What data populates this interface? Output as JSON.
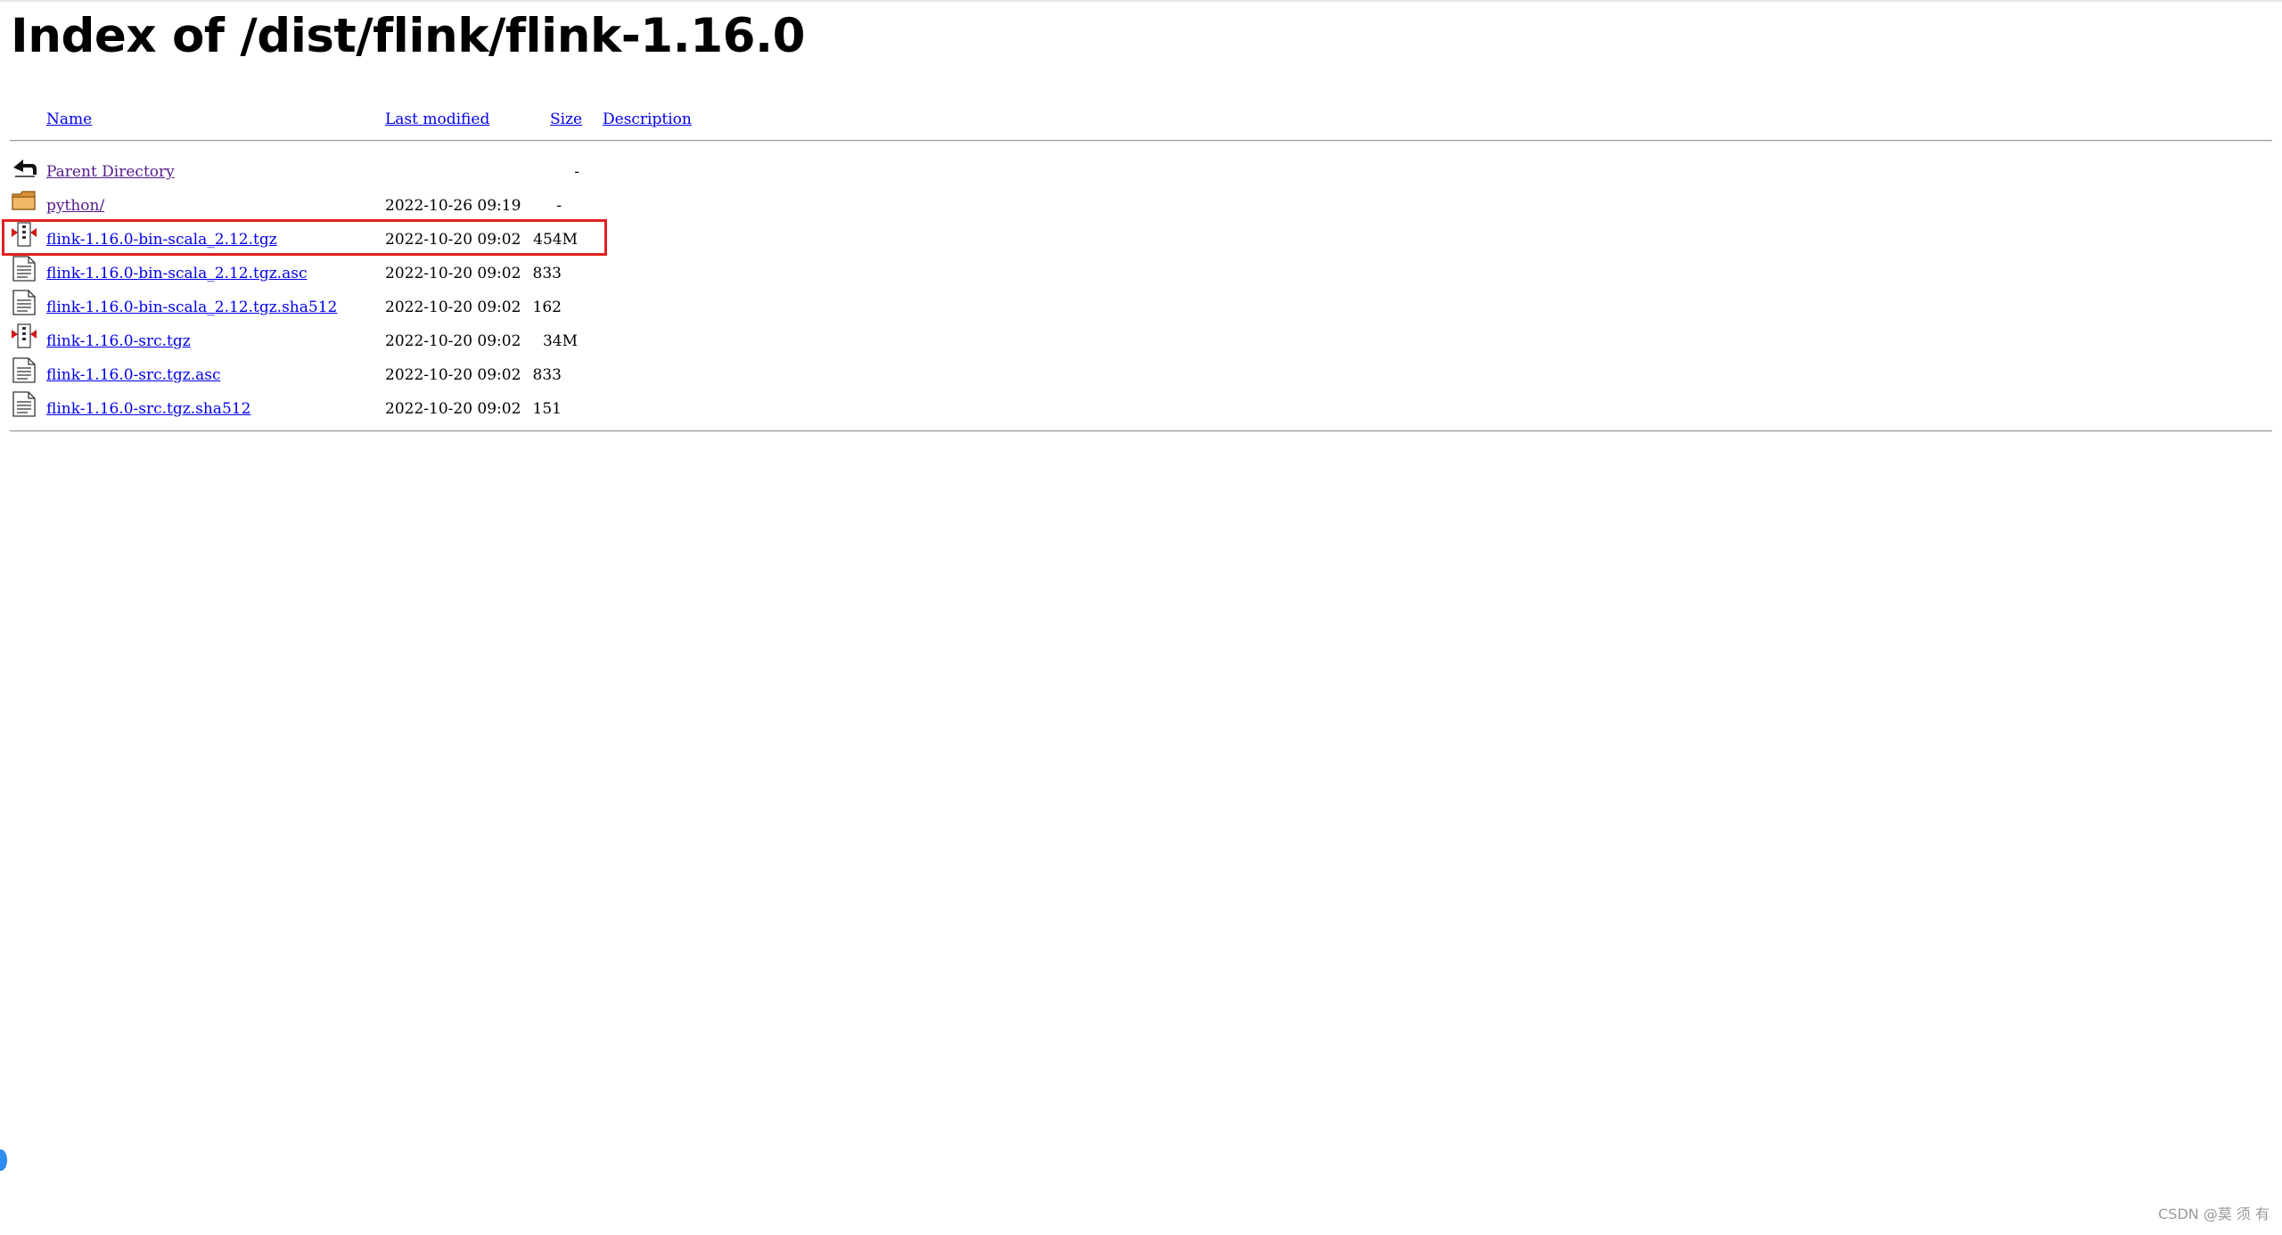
{
  "page": {
    "title": "Index of /dist/flink/flink-1.16.0"
  },
  "table": {
    "headers": {
      "name": "Name",
      "last_modified": "Last modified",
      "size": "Size",
      "description": "Description"
    },
    "rows": [
      {
        "icon": "back-icon",
        "name": "Parent Directory",
        "date": "",
        "size": "-"
      },
      {
        "icon": "folder-icon",
        "name": "python/",
        "date": "2022-10-26 09:19",
        "size": "-"
      },
      {
        "icon": "archive-icon",
        "name": "flink-1.16.0-bin-scala_2.12.tgz",
        "date": "2022-10-20 09:02",
        "size": "454M"
      },
      {
        "icon": "text-file-icon",
        "name": "flink-1.16.0-bin-scala_2.12.tgz.asc",
        "date": "2022-10-20 09:02",
        "size": "833"
      },
      {
        "icon": "text-file-icon",
        "name": "flink-1.16.0-bin-scala_2.12.tgz.sha512",
        "date": "2022-10-20 09:02",
        "size": "162"
      },
      {
        "icon": "archive-icon",
        "name": "flink-1.16.0-src.tgz",
        "date": "2022-10-20 09:02",
        "size": "34M"
      },
      {
        "icon": "text-file-icon",
        "name": "flink-1.16.0-src.tgz.asc",
        "date": "2022-10-20 09:02",
        "size": "833"
      },
      {
        "icon": "text-file-icon",
        "name": "flink-1.16.0-src.tgz.sha512",
        "date": "2022-10-20 09:02",
        "size": "151"
      }
    ]
  },
  "watermark": "CSDN @莫 须 有",
  "colors": {
    "link": "#0000ee",
    "visited_link": "#551a8b",
    "highlight_box": "#e02020",
    "floating_dot": "#2d8cf0"
  }
}
